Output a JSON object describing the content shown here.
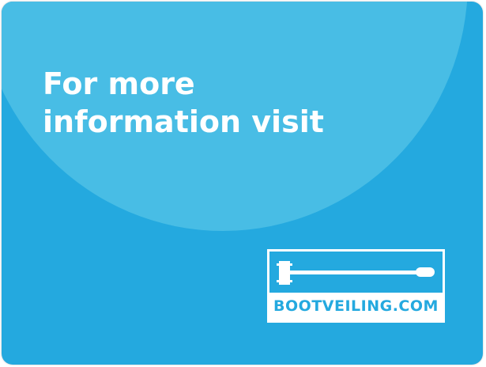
{
  "headline": {
    "line1": "For more",
    "line2": "information visit"
  },
  "logo": {
    "icon": "gavel-icon",
    "text": "BOOTVEILING.COM"
  },
  "colors": {
    "background": "#24a9df",
    "circle": "#48bde5",
    "text": "#ffffff"
  }
}
